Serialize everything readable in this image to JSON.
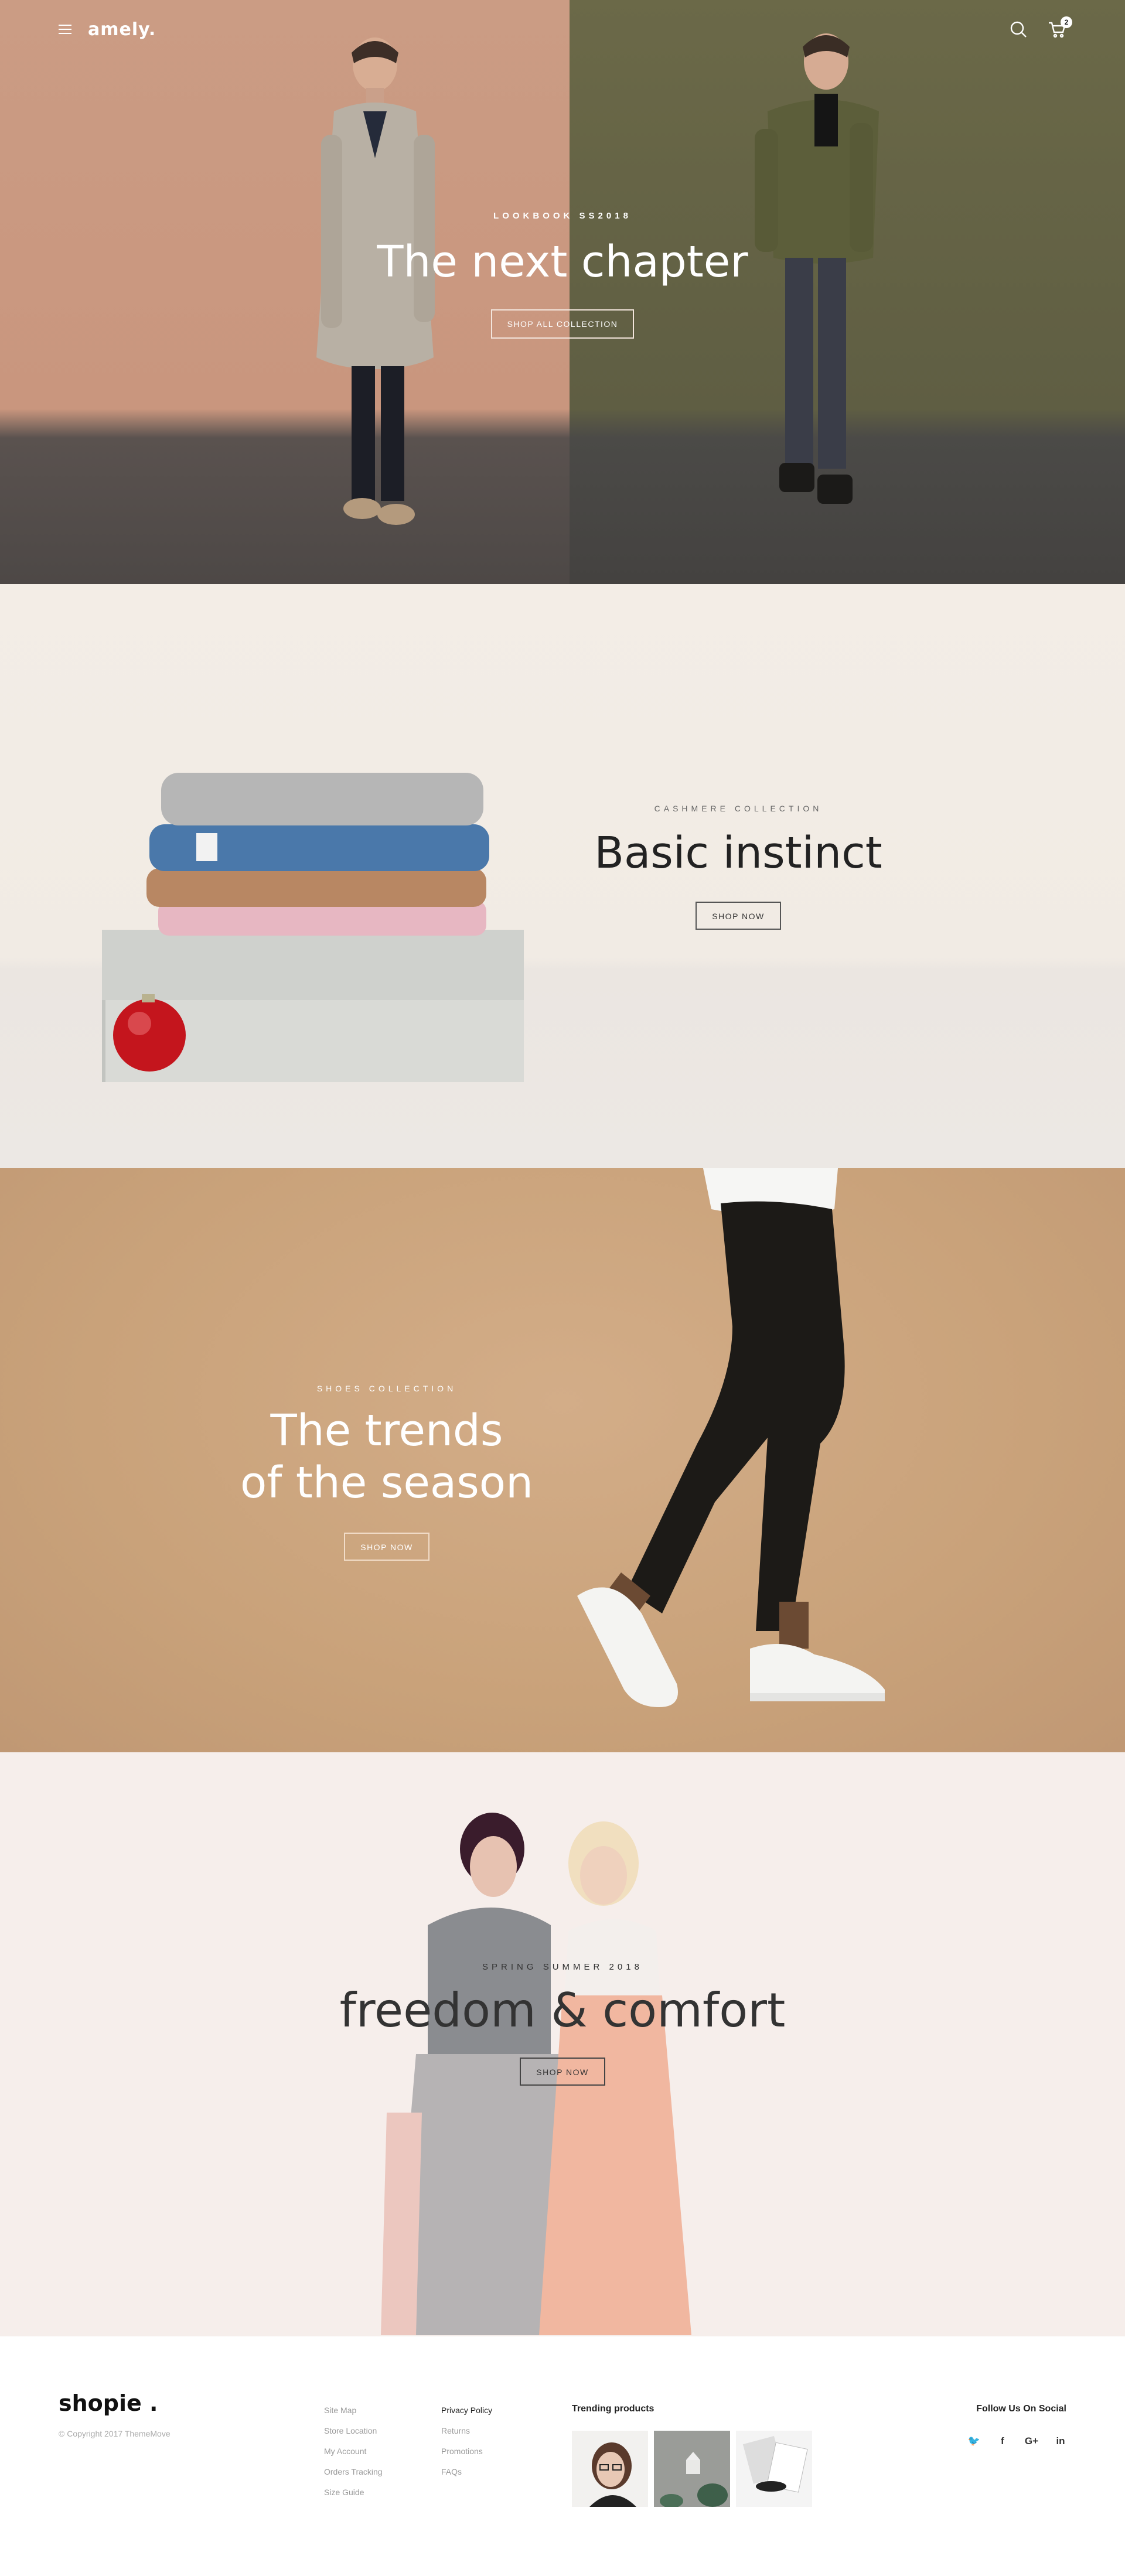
{
  "header": {
    "logo": "amely.",
    "cart_count": "2"
  },
  "hero": {
    "eyebrow": "LOOKBOOK SS2018",
    "headline": "The next chapter",
    "button": "SHOP ALL COLLECTION"
  },
  "cashmere": {
    "eyebrow": "CASHMERE COLLECTION",
    "headline": "Basic instinct",
    "button": "SHOP NOW"
  },
  "shoes": {
    "eyebrow": "SHOES COLLECTION",
    "headline_line1": "The trends",
    "headline_line2": "of the season",
    "button": "SHOP NOW"
  },
  "freedom": {
    "eyebrow": "SPRING SUMMER 2018",
    "headline": "freedom & comfort",
    "button": "SHOP NOW"
  },
  "footer": {
    "logo": "shopie .",
    "copyright": "© Copyright 2017 ThemeMove",
    "links_col1": [
      "Site Map",
      "Store Location",
      "My Account",
      "Orders Tracking",
      "Size Guide"
    ],
    "links_col2": [
      "Privacy Policy",
      "Returns",
      "Promotions",
      "FAQs"
    ],
    "trending_title": "Trending products",
    "social_title": "Follow Us On Social",
    "social_icons": [
      "twitter-icon",
      "facebook-icon",
      "google-plus-icon",
      "linkedin-icon"
    ],
    "social_glyphs": [
      "🐦",
      "f",
      "G+",
      "in"
    ]
  }
}
